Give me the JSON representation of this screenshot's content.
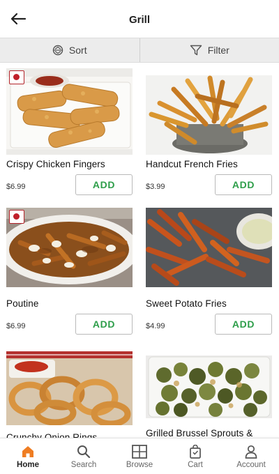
{
  "header": {
    "title": "Grill"
  },
  "toolbar": {
    "sort_label": "Sort",
    "filter_label": "Filter"
  },
  "items": [
    {
      "name": "Crispy Chicken Fingers",
      "price": "$6.99",
      "add_label": "ADD",
      "badge": true
    },
    {
      "name": "Handcut French Fries",
      "price": "$3.99",
      "add_label": "ADD",
      "badge": false
    },
    {
      "name": "Poutine",
      "price": "$6.99",
      "add_label": "ADD",
      "badge": true
    },
    {
      "name": "Sweet Potato Fries",
      "price": "$4.99",
      "add_label": "ADD",
      "badge": false
    },
    {
      "name": "Crunchy Onion Rings",
      "badge": false
    },
    {
      "name": "Grilled Brussel Sprouts &",
      "badge": false
    }
  ],
  "nav": [
    {
      "label": "Home",
      "icon": "home-icon",
      "active": true
    },
    {
      "label": "Search",
      "icon": "search-icon",
      "active": false
    },
    {
      "label": "Browse",
      "icon": "browse-icon",
      "active": false
    },
    {
      "label": "Cart",
      "icon": "cart-icon",
      "active": false
    },
    {
      "label": "Account",
      "icon": "account-icon",
      "active": false
    }
  ],
  "colors": {
    "accent": "#2e9e4a",
    "home_active": "#ef7d22",
    "badge": "#c0202a",
    "toolbar_bg": "#ececec"
  }
}
